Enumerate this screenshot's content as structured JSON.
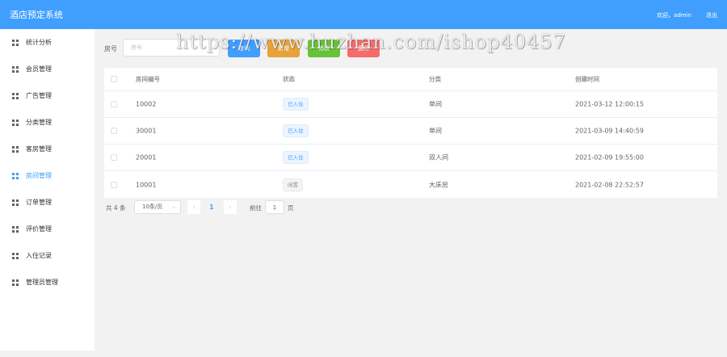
{
  "header": {
    "title": "酒店预定系统",
    "user_text": "欢迎，admin",
    "logout_label": "退出"
  },
  "sidebar": {
    "items": [
      {
        "label": "统计分析"
      },
      {
        "label": "会员管理"
      },
      {
        "label": "广告管理"
      },
      {
        "label": "分类管理"
      },
      {
        "label": "客房管理"
      },
      {
        "label": "房间管理",
        "active": true
      },
      {
        "label": "订单管理"
      },
      {
        "label": "评价管理"
      },
      {
        "label": "入住记录"
      },
      {
        "label": "管理员管理"
      }
    ]
  },
  "search": {
    "label": "房号",
    "placeholder": "房号",
    "value": ""
  },
  "toolbar": {
    "buttons": [
      "查询",
      "新增",
      "修改",
      "删除"
    ]
  },
  "table": {
    "headers": [
      "房间编号",
      "状态",
      "分类",
      "创建时间"
    ],
    "rows": [
      {
        "no": "10002",
        "status": "已入住",
        "type": "单间",
        "time": "2021-03-12 12:00:15"
      },
      {
        "no": "30001",
        "status": "已入住",
        "type": "单间",
        "time": "2021-03-09 14:40:59"
      },
      {
        "no": "20001",
        "status": "已入住",
        "type": "双人间",
        "time": "2021-02-09 19:55:00"
      },
      {
        "no": "10001",
        "status": "闲置",
        "type": "大床房",
        "time": "2021-02-08 22:52:57"
      }
    ]
  },
  "pagination": {
    "total_text": "共 4 条",
    "page_size": "10条/页",
    "current_page": "1",
    "goto_label": "前往",
    "goto_value": "1",
    "goto_unit": "页"
  },
  "watermark": "https://www.huzhan.com/ishop40457",
  "colors": {
    "primary": "#409eff",
    "warning": "#e6a23c",
    "success": "#67c23a",
    "danger": "#f56c6c"
  }
}
